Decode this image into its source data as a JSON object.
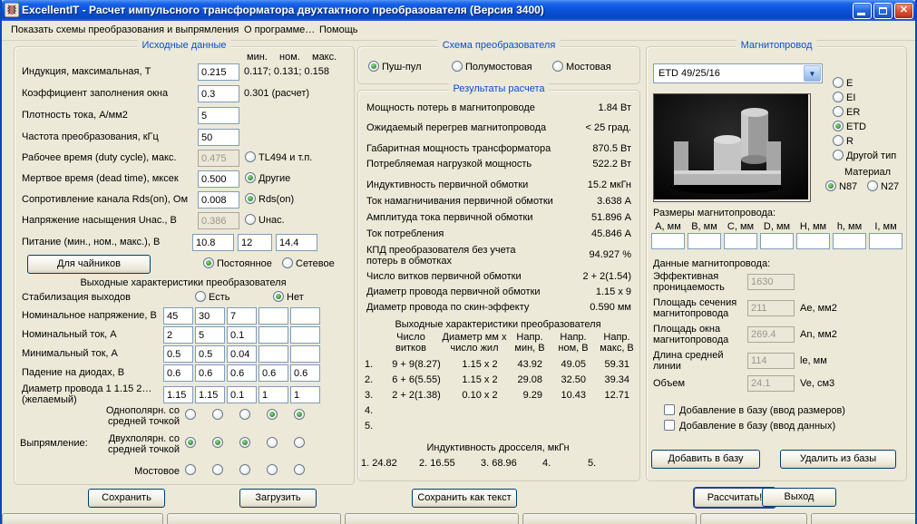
{
  "titlebar": {
    "title": "ExcellentIT - Расчет импульсного трансформатора двухтактного преобразователя (Версия 3400)"
  },
  "menu": {
    "show_schemes": "Показать схемы преобразования и выпрямления",
    "about": "О программе…",
    "help": "Помощь"
  },
  "left": {
    "title": "Исходные данные",
    "hdr_min": "мин.",
    "hdr_nom": "ном.",
    "hdr_max": "макс.",
    "r1_label": "Индукция, максимальная, Т",
    "r1_value": "0.215",
    "r1_extra": "0.117; 0.131; 0.158",
    "r2_label": "Коэффициент заполнения окна",
    "r2_value": "0.3",
    "r2_extra": "0.301 (расчет)",
    "r3_label": "Плотность тока, А/мм2",
    "r3_value": "5",
    "r4_label": "Частота преобразования, кГц",
    "r4_value": "50",
    "r5_label": "Рабочее время (duty cycle), макс.",
    "r5_value": "0.475",
    "r5_radio": "TL494 и т.п.",
    "r6_label": "Мертвое время (dead time), мксек",
    "r6_value": "0.500",
    "r6_radio": "Другие",
    "r7_label": "Сопротивление канала Rds(on), Ом",
    "r7_value": "0.008",
    "r7_radio": "Rds(on)",
    "r8_label": "Напряжение насыщения Uнас., В",
    "r8_value": "0.386",
    "r8_radio": "Uнас.",
    "r9_label": "Питание (мин., ном., макс.), В",
    "r9_min": "10.8",
    "r9_nom": "12",
    "r9_max": "14.4",
    "beginners": "Для чайников",
    "dc": "Постоянное",
    "ac": "Сетевое",
    "supply_selected": "Постоянное",
    "out_title": "Выходные характеристики преобразователя",
    "stab_label": "Стабилизация выходов",
    "stab_yes": "Есть",
    "stab_no": "Нет",
    "stab_selected": "Нет",
    "g1_label": "Номинальное напряжение, В",
    "g1": [
      "45",
      "30",
      "7",
      "",
      ""
    ],
    "g2_label": "Номинальный ток, А",
    "g2": [
      "2",
      "5",
      "0.1",
      "",
      ""
    ],
    "g3_label": "Минимальный ток, А",
    "g3": [
      "0.5",
      "0.5",
      "0.04",
      "",
      ""
    ],
    "g4_label": "Падение на диодах, В",
    "g4": [
      "0.6",
      "0.6",
      "0.6",
      "0.6",
      "0.6"
    ],
    "g5_label": "Диаметр провода 1 1.15 2…",
    "g5_label2": "(желаемый)",
    "g5": [
      "1.15",
      "1.15",
      "0.1",
      "1",
      "1"
    ],
    "rect_label": "Выпрямление:",
    "rect1": "Однополярн. со средней точкой",
    "rect2": "Двухполярн. со средней точкой",
    "rect3": "Мостовое",
    "rect_selected_by_column": [
      "rect2",
      "rect2",
      "rect2",
      "rect1",
      "rect1"
    ],
    "save": "Сохранить",
    "load": "Загрузить"
  },
  "schema": {
    "title": "Схема преобразователя",
    "opt1": "Пуш-пул",
    "opt2": "Полумостовая",
    "opt3": "Мостовая",
    "selected": "Пуш-пул"
  },
  "results": {
    "title": "Результаты расчета",
    "p1_label": "Мощность потерь в магнитопроводе",
    "p1_value": "1.84 Вт",
    "p2_label": "Ожидаемый перегрев магнитопровода",
    "p2_value": "< 25 град.",
    "p3_label": "Габаритная мощность трансформатора",
    "p3_value": "870.5 Вт",
    "p4_label": "Потребляемая нагрузкой мощность",
    "p4_value": "522.2 Вт",
    "p5_label": "Индуктивность первичной обмотки",
    "p5_value": "15.2 мкГн",
    "p6_label": "Ток намагничивания первичной обмотки",
    "p6_value": "3.638 А",
    "p7_label": "Амплитуда тока первичной обмотки",
    "p7_value": "51.896 А",
    "p8_label": "Ток потребления",
    "p8_value": "45.846 А",
    "p9_label": "КПД преобразователя без учета потерь в обмотках",
    "p9_value": "94.927 %",
    "p10_label": "Число витков первичной обмотки",
    "p10_value": "2 + 2(1.54)",
    "p11_label": "Диаметр провода первичной обмотки",
    "p11_value": "1.15 х 9",
    "p12_label": "Диаметр провода по скин-эффекту",
    "p12_value": "0.590 мм",
    "out_title": "Выходные характеристики преобразователя",
    "h1": "Число витков",
    "h2": "Диаметр мм х число жил",
    "h3": "Напр. мин, В",
    "h4": "Напр. ном, В",
    "h5": "Напр. макс, В",
    "rows": [
      {
        "n": "1.",
        "turns": "9 + 9(8.27)",
        "wire": "1.15 х 2",
        "vmin": "43.92",
        "vnom": "49.05",
        "vmax": "59.31"
      },
      {
        "n": "2.",
        "turns": "6 + 6(5.55)",
        "wire": "1.15 х 2",
        "vmin": "29.08",
        "vnom": "32.50",
        "vmax": "39.34"
      },
      {
        "n": "3.",
        "turns": "2 + 2(1.38)",
        "wire": "0.10 х 2",
        "vmin": "9.29",
        "vnom": "10.43",
        "vmax": "12.71"
      },
      {
        "n": "4.",
        "turns": "",
        "wire": "",
        "vmin": "",
        "vnom": "",
        "vmax": ""
      },
      {
        "n": "5.",
        "turns": "",
        "wire": "",
        "vmin": "",
        "vnom": "",
        "vmax": ""
      }
    ],
    "choke_title": "Индуктивность дросселя, мкГн",
    "choke": [
      "1. 24.82",
      "2. 16.55",
      "3. 68.96",
      "4.",
      "5."
    ],
    "save_text": "Сохранить как текст",
    "calc": "Рассчитать!"
  },
  "core": {
    "title": "Магнитопровод",
    "combo": "ETD 49/25/16",
    "t1": "E",
    "t2": "EI",
    "t3": "ER",
    "t4": "ETD",
    "t5": "R",
    "t6": "Другой тип",
    "selected_type": "ETD",
    "material": "Материал",
    "m1": "N87",
    "m2": "N27",
    "selected_material": "N87",
    "dims_title": "Размеры магнитопровода:",
    "dims": [
      "А, мм",
      "В, мм",
      "С, мм",
      "D, мм",
      "Н, мм",
      "h, мм",
      "I, мм"
    ],
    "data_title": "Данные магнитопровода:",
    "d1_label": "Эффективная проницаемость",
    "d1_value": "1630",
    "d2_label": "Площадь сечения магнитопровода",
    "d2_value": "211",
    "d2_unit": "Ае, мм2",
    "d3_label": "Площадь окна магнитопровода",
    "d3_value": "269.4",
    "d3_unit": "Аn, мм2",
    "d4_label": "Длина средней линии",
    "d4_value": "114",
    "d4_unit": "le, мм",
    "d5_label": "Объем",
    "d5_value": "24.1",
    "d5_unit": "Ve, см3",
    "cb1": "Добавление в базу (ввод размеров)",
    "cb2": "Добавление в базу (ввод данных)",
    "add": "Добавить в базу",
    "remove": "Удалить из базы"
  },
  "exit": "Выход"
}
